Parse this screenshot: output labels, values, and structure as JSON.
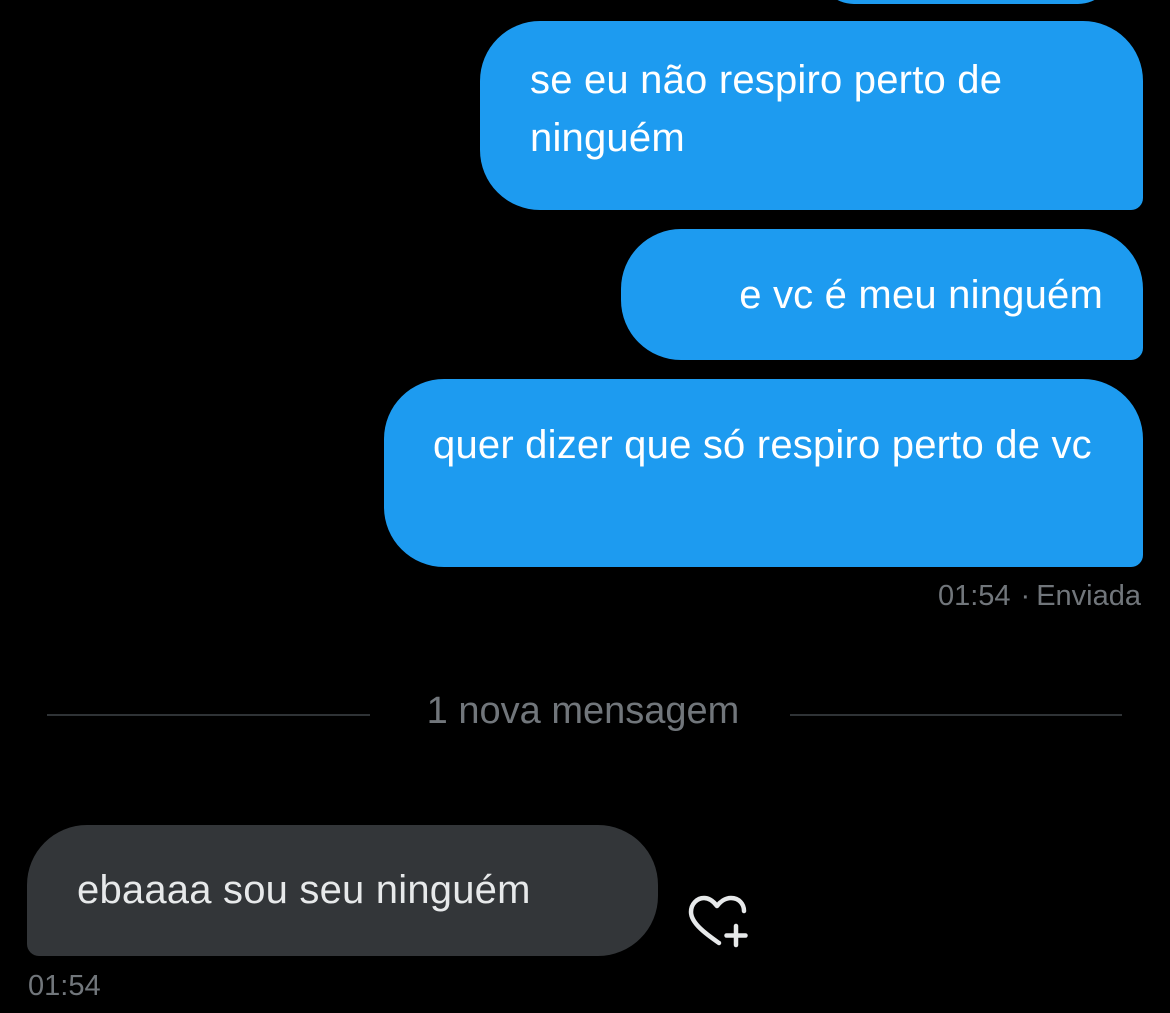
{
  "conversation": {
    "sent_messages": [
      {
        "text": "se eu não respiro perto de ninguém"
      },
      {
        "text": "e vc é meu ninguém"
      },
      {
        "text": "quer dizer que só respiro perto de vc"
      }
    ],
    "sent_meta": {
      "time": "01:54",
      "separator": "·",
      "status": "Enviada"
    },
    "new_messages_divider": "1 nova mensagem",
    "received_messages": [
      {
        "text": "ebaaaa sou seu ninguém",
        "time": "01:54"
      }
    ]
  },
  "colors": {
    "background": "#000000",
    "sent_bubble": "#1D9BF0",
    "received_bubble": "#333639",
    "meta_text": "#71767B",
    "divider": "#2F3336"
  },
  "icons": {
    "react": "heart-plus-icon"
  }
}
